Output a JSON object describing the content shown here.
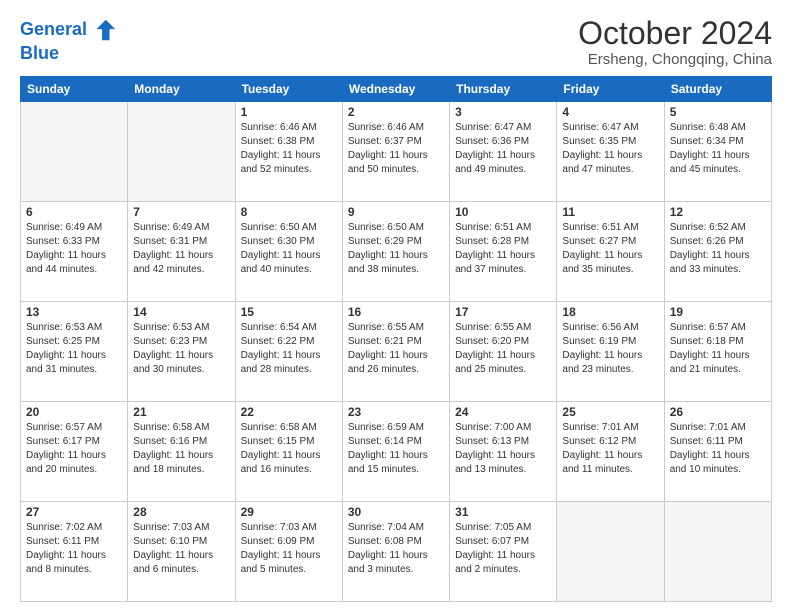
{
  "logo": {
    "line1": "General",
    "line2": "Blue"
  },
  "title": "October 2024",
  "subtitle": "Ersheng, Chongqing, China",
  "days_of_week": [
    "Sunday",
    "Monday",
    "Tuesday",
    "Wednesday",
    "Thursday",
    "Friday",
    "Saturday"
  ],
  "weeks": [
    [
      {
        "day": "",
        "empty": true
      },
      {
        "day": "",
        "empty": true
      },
      {
        "day": "1",
        "sunrise": "6:46 AM",
        "sunset": "6:38 PM",
        "daylight": "11 hours and 52 minutes."
      },
      {
        "day": "2",
        "sunrise": "6:46 AM",
        "sunset": "6:37 PM",
        "daylight": "11 hours and 50 minutes."
      },
      {
        "day": "3",
        "sunrise": "6:47 AM",
        "sunset": "6:36 PM",
        "daylight": "11 hours and 49 minutes."
      },
      {
        "day": "4",
        "sunrise": "6:47 AM",
        "sunset": "6:35 PM",
        "daylight": "11 hours and 47 minutes."
      },
      {
        "day": "5",
        "sunrise": "6:48 AM",
        "sunset": "6:34 PM",
        "daylight": "11 hours and 45 minutes."
      }
    ],
    [
      {
        "day": "6",
        "sunrise": "6:49 AM",
        "sunset": "6:33 PM",
        "daylight": "11 hours and 44 minutes."
      },
      {
        "day": "7",
        "sunrise": "6:49 AM",
        "sunset": "6:31 PM",
        "daylight": "11 hours and 42 minutes."
      },
      {
        "day": "8",
        "sunrise": "6:50 AM",
        "sunset": "6:30 PM",
        "daylight": "11 hours and 40 minutes."
      },
      {
        "day": "9",
        "sunrise": "6:50 AM",
        "sunset": "6:29 PM",
        "daylight": "11 hours and 38 minutes."
      },
      {
        "day": "10",
        "sunrise": "6:51 AM",
        "sunset": "6:28 PM",
        "daylight": "11 hours and 37 minutes."
      },
      {
        "day": "11",
        "sunrise": "6:51 AM",
        "sunset": "6:27 PM",
        "daylight": "11 hours and 35 minutes."
      },
      {
        "day": "12",
        "sunrise": "6:52 AM",
        "sunset": "6:26 PM",
        "daylight": "11 hours and 33 minutes."
      }
    ],
    [
      {
        "day": "13",
        "sunrise": "6:53 AM",
        "sunset": "6:25 PM",
        "daylight": "11 hours and 31 minutes."
      },
      {
        "day": "14",
        "sunrise": "6:53 AM",
        "sunset": "6:23 PM",
        "daylight": "11 hours and 30 minutes."
      },
      {
        "day": "15",
        "sunrise": "6:54 AM",
        "sunset": "6:22 PM",
        "daylight": "11 hours and 28 minutes."
      },
      {
        "day": "16",
        "sunrise": "6:55 AM",
        "sunset": "6:21 PM",
        "daylight": "11 hours and 26 minutes."
      },
      {
        "day": "17",
        "sunrise": "6:55 AM",
        "sunset": "6:20 PM",
        "daylight": "11 hours and 25 minutes."
      },
      {
        "day": "18",
        "sunrise": "6:56 AM",
        "sunset": "6:19 PM",
        "daylight": "11 hours and 23 minutes."
      },
      {
        "day": "19",
        "sunrise": "6:57 AM",
        "sunset": "6:18 PM",
        "daylight": "11 hours and 21 minutes."
      }
    ],
    [
      {
        "day": "20",
        "sunrise": "6:57 AM",
        "sunset": "6:17 PM",
        "daylight": "11 hours and 20 minutes."
      },
      {
        "day": "21",
        "sunrise": "6:58 AM",
        "sunset": "6:16 PM",
        "daylight": "11 hours and 18 minutes."
      },
      {
        "day": "22",
        "sunrise": "6:58 AM",
        "sunset": "6:15 PM",
        "daylight": "11 hours and 16 minutes."
      },
      {
        "day": "23",
        "sunrise": "6:59 AM",
        "sunset": "6:14 PM",
        "daylight": "11 hours and 15 minutes."
      },
      {
        "day": "24",
        "sunrise": "7:00 AM",
        "sunset": "6:13 PM",
        "daylight": "11 hours and 13 minutes."
      },
      {
        "day": "25",
        "sunrise": "7:01 AM",
        "sunset": "6:12 PM",
        "daylight": "11 hours and 11 minutes."
      },
      {
        "day": "26",
        "sunrise": "7:01 AM",
        "sunset": "6:11 PM",
        "daylight": "11 hours and 10 minutes."
      }
    ],
    [
      {
        "day": "27",
        "sunrise": "7:02 AM",
        "sunset": "6:11 PM",
        "daylight": "11 hours and 8 minutes."
      },
      {
        "day": "28",
        "sunrise": "7:03 AM",
        "sunset": "6:10 PM",
        "daylight": "11 hours and 6 minutes."
      },
      {
        "day": "29",
        "sunrise": "7:03 AM",
        "sunset": "6:09 PM",
        "daylight": "11 hours and 5 minutes."
      },
      {
        "day": "30",
        "sunrise": "7:04 AM",
        "sunset": "6:08 PM",
        "daylight": "11 hours and 3 minutes."
      },
      {
        "day": "31",
        "sunrise": "7:05 AM",
        "sunset": "6:07 PM",
        "daylight": "11 hours and 2 minutes."
      },
      {
        "day": "",
        "empty": true
      },
      {
        "day": "",
        "empty": true
      }
    ]
  ]
}
